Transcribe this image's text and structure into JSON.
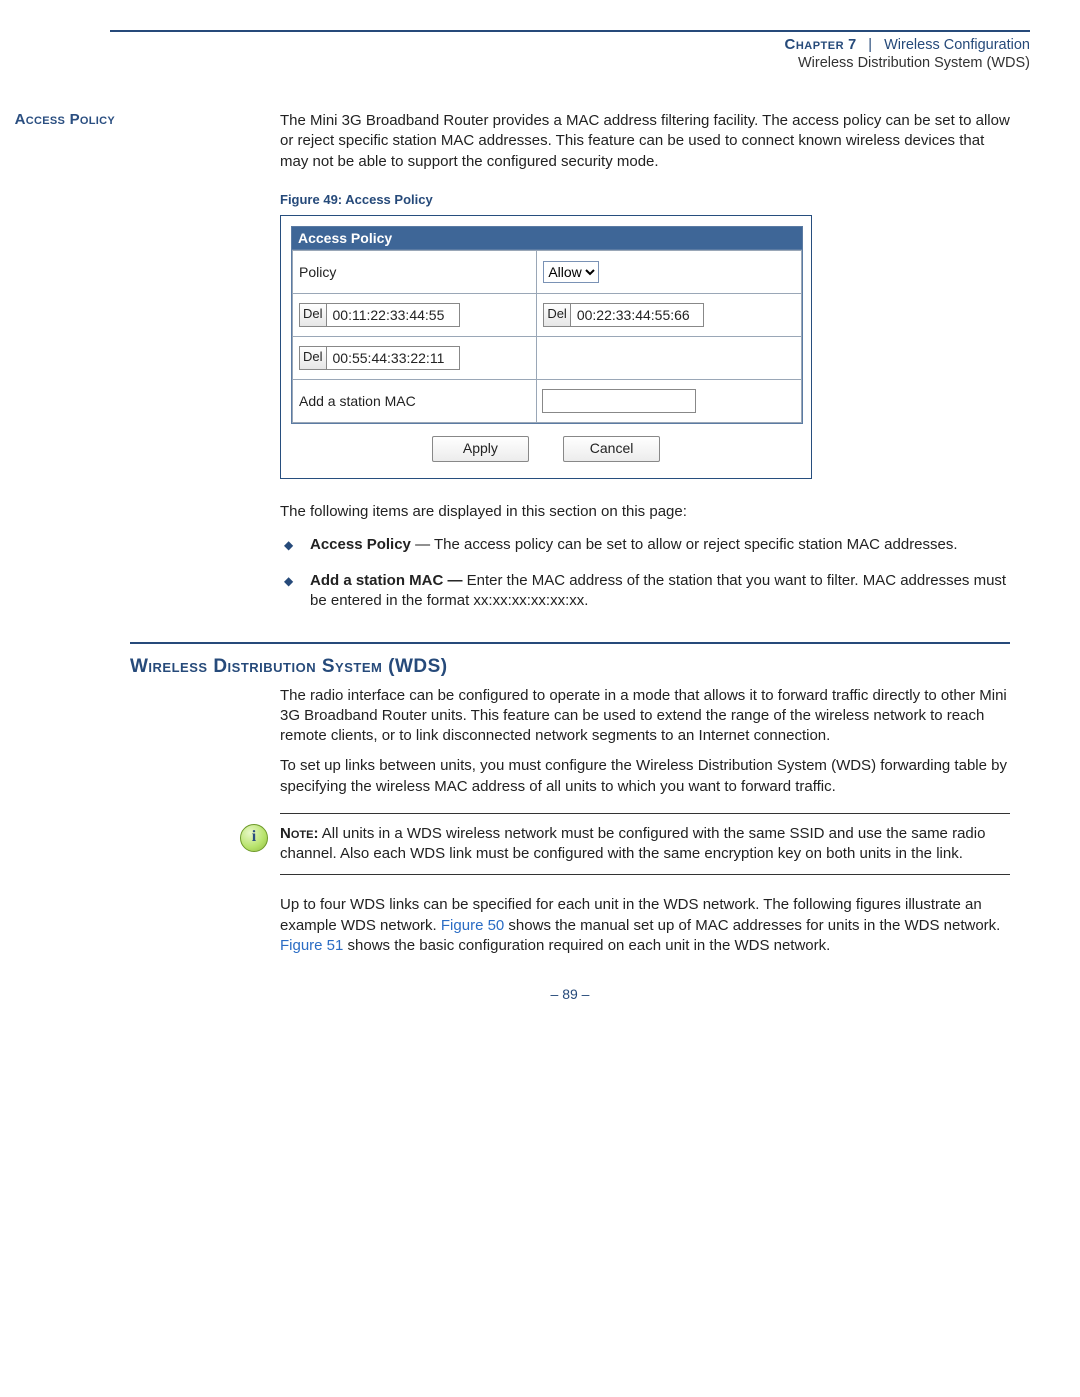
{
  "header": {
    "chapter_label": "Chapter",
    "chapter_num": "7",
    "separator": "|",
    "chapter_title": "Wireless Configuration",
    "subsection": "Wireless Distribution System (WDS)"
  },
  "access_policy": {
    "label": "Access Policy",
    "para": "The Mini 3G Broadband Router provides a MAC address filtering facility. The access policy can be set to allow or reject specific station MAC addresses. This feature can be used to connect known wireless devices that may not be able to support the configured security mode.",
    "figure_caption": "Figure 49:  Access Policy",
    "panel_title": "Access Policy",
    "rows": {
      "policy_label": "Policy",
      "policy_value": "Allow",
      "del_label": "Del",
      "mac1": "00:11:22:33:44:55",
      "mac2": "00:22:33:44:55:66",
      "mac3": "00:55:44:33:22:11",
      "add_label": "Add a station MAC"
    },
    "apply": "Apply",
    "cancel": "Cancel",
    "items_intro": "The following items are displayed in this section on this page:",
    "bullet1_bold": "Access Policy",
    "bullet1_text": " — The access policy can be set to allow or reject specific station MAC addresses.",
    "bullet2_bold": "Add a station MAC —",
    "bullet2_text": " Enter the MAC address of the station that you want to filter. MAC addresses must be entered in the format xx:xx:xx:xx:xx:xx."
  },
  "wds": {
    "heading": "Wireless Distribution System (WDS)",
    "para1": "The radio interface can be configured to operate in a mode that allows it to forward traffic directly to other Mini 3G Broadband Router units. This feature can be used to extend the range of the wireless network to reach remote clients, or to link disconnected network segments to an Internet connection.",
    "para2": "To set up links between units, you must configure the Wireless Distribution System (WDS) forwarding table by specifying the wireless MAC address of all units to which you want to forward traffic.",
    "note_label": "Note:",
    "note_icon": "i",
    "note_text": " All units in a WDS wireless network must be configured with the same SSID and use the same radio channel. Also each WDS link must be configured with the same encryption key on both units in the link.",
    "para3_a": "Up to four WDS links can be specified for each unit in the WDS network. The following figures illustrate an example WDS network. ",
    "fig50": "Figure 50",
    "para3_b": " shows the manual set up of MAC addresses for units in the WDS network. ",
    "fig51": "Figure 51",
    "para3_c": " shows the basic configuration required on each unit in the WDS network."
  },
  "page_number": "–  89  –"
}
